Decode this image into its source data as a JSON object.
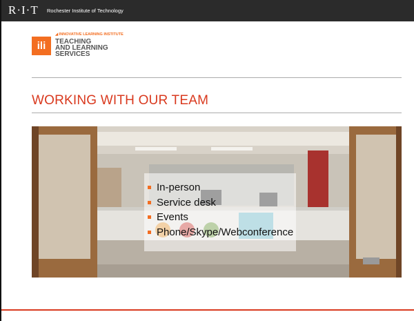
{
  "header": {
    "logo": "R·I·T",
    "institution": "Rochester Institute of Technology"
  },
  "brand": {
    "badge": "ili",
    "tagline": "◢ INNOVATIVE LEARNING INSTITUTE",
    "line1": "TEACHING",
    "line2": "AND LEARNING",
    "line3": "SERVICES"
  },
  "slide": {
    "title": "WORKING WITH OUR TEAM",
    "bullets": [
      "In-person",
      "Service desk",
      "Events",
      "Phone/Skype/Webconference"
    ]
  },
  "colors": {
    "accent": "#f36e21",
    "title": "#d9391e",
    "topbar": "#2b2b2b"
  }
}
